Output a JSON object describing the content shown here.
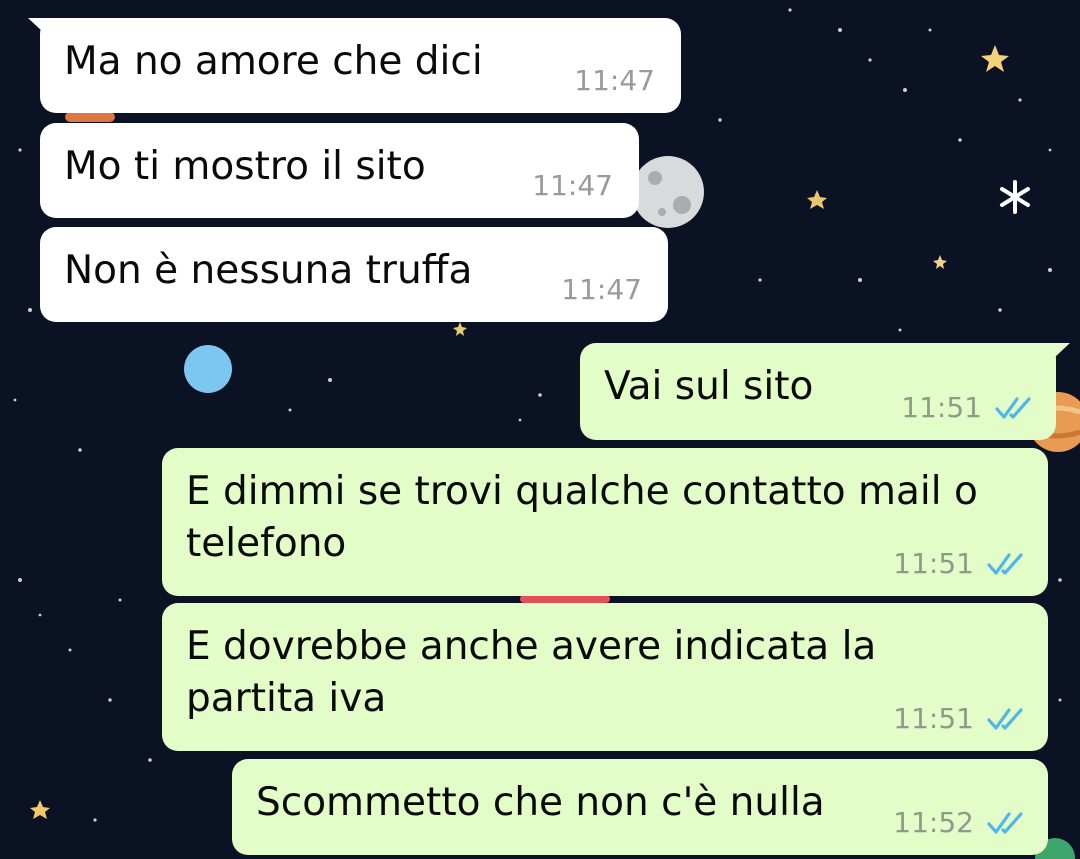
{
  "chat": {
    "messages": [
      {
        "direction": "incoming",
        "text": "Ma no amore che dici",
        "time": "11:47"
      },
      {
        "direction": "incoming",
        "text": "Mo ti mostro il sito",
        "time": "11:47"
      },
      {
        "direction": "incoming",
        "text": "Non è nessuna truffa",
        "time": "11:47"
      },
      {
        "direction": "outgoing",
        "text": "Vai sul sito",
        "time": "11:51",
        "status": "read-ticks-icon"
      },
      {
        "direction": "outgoing",
        "text": "E dimmi se trovi qualche contatto mail o telefono",
        "time": "11:51",
        "status": "read-ticks-icon"
      },
      {
        "direction": "outgoing",
        "text": "E dovrebbe anche avere indicata la partita iva",
        "time": "11:51",
        "status": "read-ticks-icon"
      },
      {
        "direction": "outgoing",
        "text": "Scommetto che non c'è nulla",
        "time": "11:52",
        "status": "read-ticks-icon"
      }
    ]
  },
  "colors": {
    "wallpaper": "#0b1223",
    "incoming_bubble": "#ffffff",
    "outgoing_bubble": "#e2fdc8",
    "read_ticks": "#4fb6ec"
  }
}
